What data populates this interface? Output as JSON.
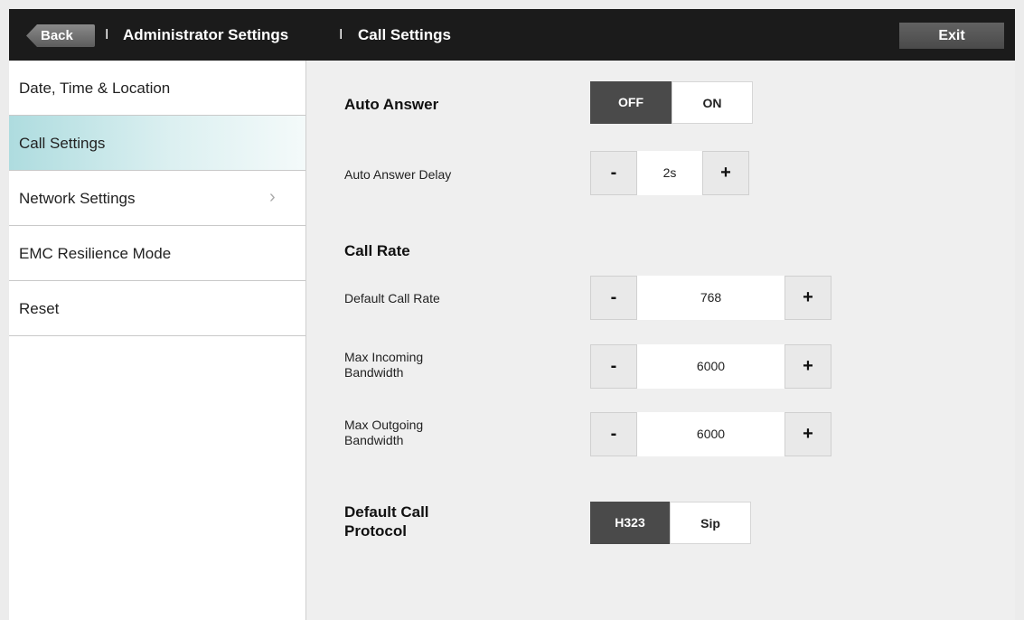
{
  "header": {
    "back_label": "Back",
    "separator": "I",
    "crumb1": "Administrator Settings",
    "crumb2": "Call Settings",
    "exit_label": "Exit"
  },
  "sidebar": {
    "items": [
      {
        "label": "Date, Time & Location"
      },
      {
        "label": "Call Settings"
      },
      {
        "label": "Network Settings"
      },
      {
        "label": "EMC Resilience Mode"
      },
      {
        "label": "Reset"
      }
    ],
    "active_index": 1
  },
  "main": {
    "auto_answer": {
      "label": "Auto Answer",
      "off": "OFF",
      "on": "ON",
      "selected": "OFF"
    },
    "auto_answer_delay": {
      "label": "Auto Answer Delay",
      "value": "2s",
      "minus": "-",
      "plus": "+"
    },
    "call_rate": {
      "label": "Call Rate"
    },
    "default_call_rate": {
      "label": "Default Call Rate",
      "value": "768",
      "minus": "-",
      "plus": "+"
    },
    "max_incoming": {
      "label_line1": "Max Incoming",
      "label_line2": "Bandwidth",
      "value": "6000",
      "minus": "-",
      "plus": "+"
    },
    "max_outgoing": {
      "label_line1": "Max Outgoing",
      "label_line2": "Bandwidth",
      "value": "6000",
      "minus": "-",
      "plus": "+"
    },
    "protocol": {
      "label_line1": "Default Call",
      "label_line2": "Protocol",
      "h323": "H323",
      "sip": "Sip",
      "selected": "H323"
    }
  },
  "icons": {
    "chevron": "chevron-right-icon"
  }
}
